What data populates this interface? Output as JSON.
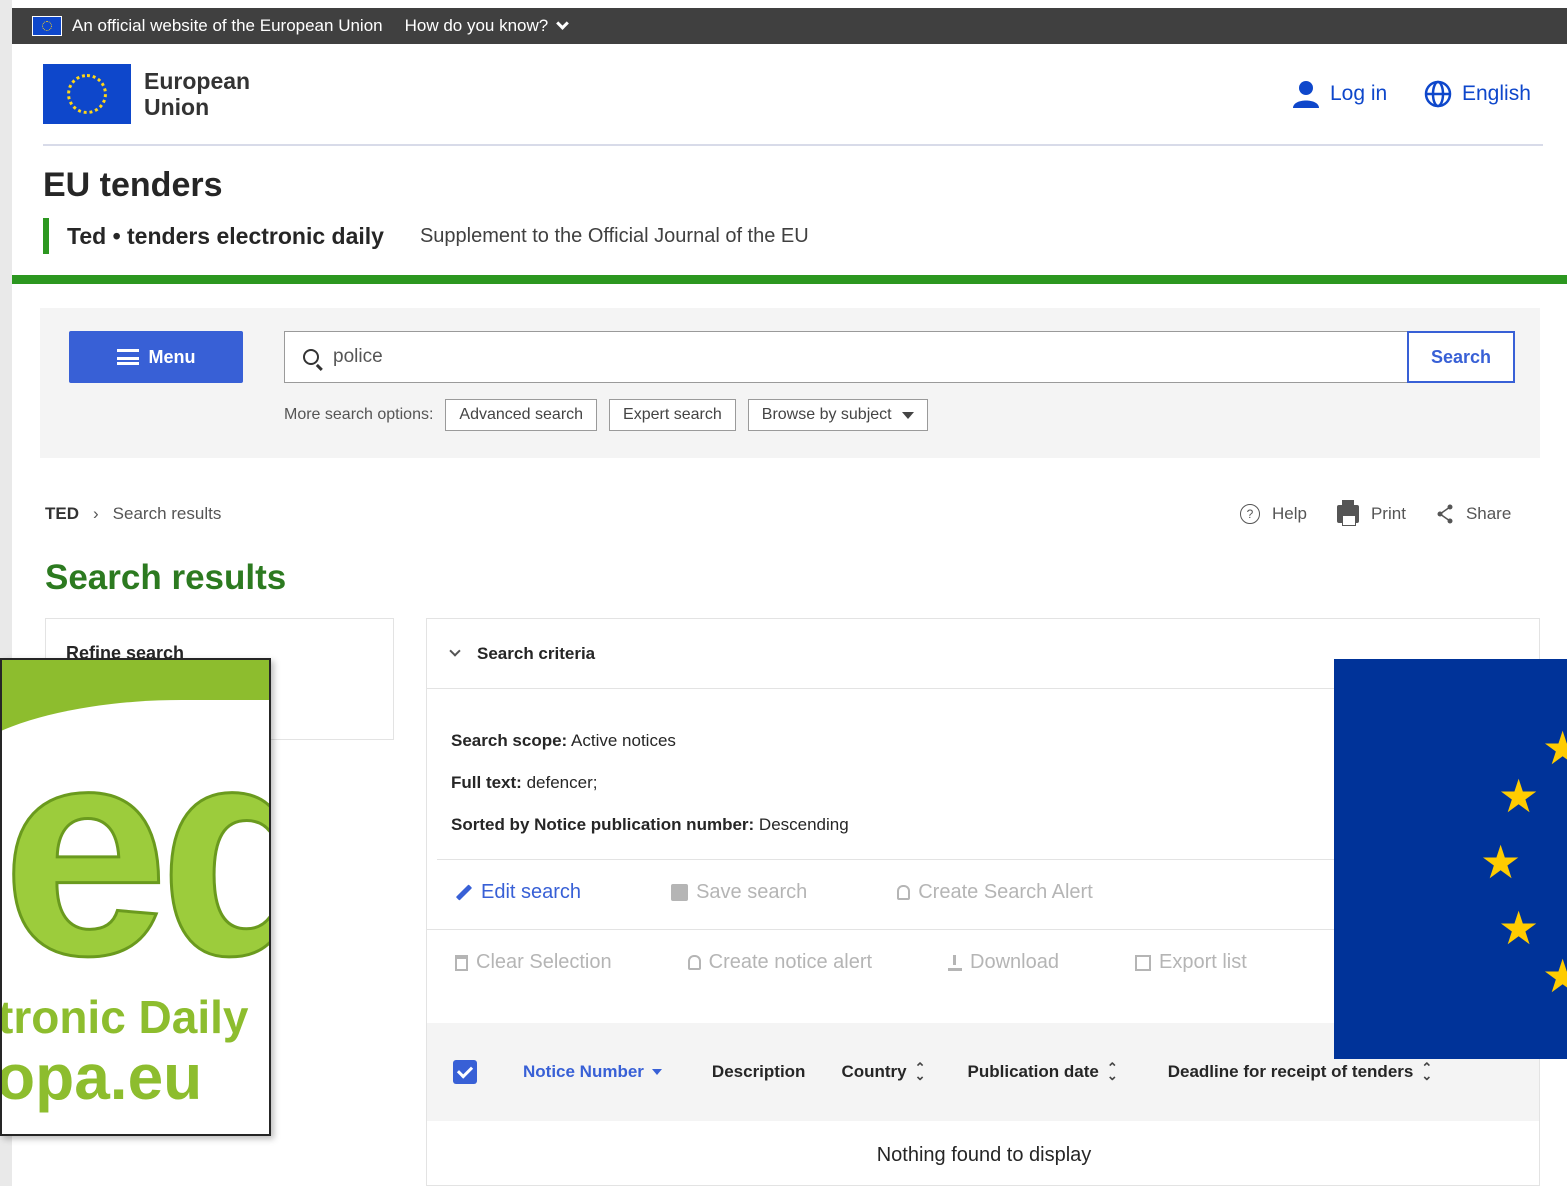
{
  "eu_bar": {
    "official_text": "An official website of the European Union",
    "how_text": "How do you know?"
  },
  "header": {
    "org_line1": "European",
    "org_line2": "Union",
    "login_label": "Log in",
    "language_label": "English"
  },
  "site": {
    "title": "EU tenders",
    "ted_label": "Ted • tenders electronic daily",
    "supplement": "Supplement to the Official Journal of the EU"
  },
  "search": {
    "menu_label": "Menu",
    "query": "police",
    "search_button": "Search",
    "more_options_label": "More search options:",
    "advanced": "Advanced search",
    "expert": "Expert search",
    "browse": "Browse by subject"
  },
  "breadcrumb": {
    "root": "TED",
    "current": "Search results"
  },
  "tools": {
    "help": "Help",
    "print": "Print",
    "share": "Share"
  },
  "page_title": "Search results",
  "refine": {
    "label": "Refine search"
  },
  "criteria": {
    "header": "Search criteria",
    "scope_label": "Search scope:",
    "scope_value": " Active notices",
    "fulltext_label": "Full text:",
    "fulltext_value": " defencer;",
    "sorted_label": "Sorted by Notice publication number:",
    "sorted_value": " Descending"
  },
  "actions": {
    "edit_search": "Edit search",
    "save_search": "Save search",
    "create_search_alert": "Create Search Alert",
    "clear_selection": "Clear Selection",
    "create_notice_alert": "Create notice alert",
    "download": "Download",
    "export_list": "Export list"
  },
  "table": {
    "columns": [
      "Notice Number",
      "Description",
      "Country",
      "Publication date",
      "Deadline for receipt of tenders"
    ],
    "empty_message": "Nothing found to display"
  },
  "ted_logo": {
    "line1": "tronic Daily",
    "line2": "opa.eu"
  },
  "colors": {
    "eu_blue": "#0e47cb",
    "ted_green": "#2c9720",
    "action_blue": "#3860d6",
    "flag_blue": "#003399",
    "flag_yellow": "#ffcc00"
  }
}
